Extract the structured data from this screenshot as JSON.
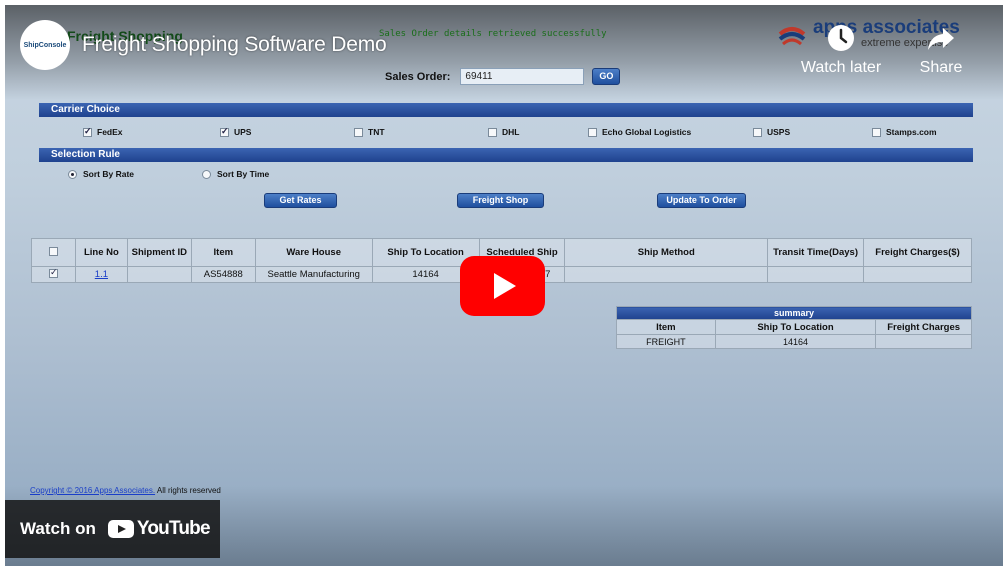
{
  "app": {
    "title": "Freight Shopping",
    "status_message": "Sales Order details retrieved successfully",
    "vendor_name": "apps associates",
    "vendor_tagline": "extreme expertise"
  },
  "sales_order": {
    "label": "Sales Order:",
    "value": "69411",
    "go_label": "GO"
  },
  "carrier_choice": {
    "title": "Carrier Choice",
    "carriers": [
      {
        "label": "FedEx",
        "checked": true
      },
      {
        "label": "UPS",
        "checked": true
      },
      {
        "label": "TNT",
        "checked": false
      },
      {
        "label": "DHL",
        "checked": false
      },
      {
        "label": "Echo Global Logistics",
        "checked": false
      },
      {
        "label": "USPS",
        "checked": false
      },
      {
        "label": "Stamps.com",
        "checked": false
      }
    ]
  },
  "selection_rule": {
    "title": "Selection Rule",
    "options": [
      {
        "label": "Sort By Rate",
        "selected": true
      },
      {
        "label": "Sort By Time",
        "selected": false
      }
    ]
  },
  "actions": {
    "get_rates": "Get Rates",
    "freight_shop": "Freight Shop",
    "update_to_order": "Update To Order"
  },
  "lines_table": {
    "headers": [
      "Line No",
      "Shipment ID",
      "Item",
      "Ware House",
      "Ship To Location",
      "Scheduled Ship",
      "Ship Method",
      "Transit Time(Days)",
      "Freight Charges($)"
    ],
    "rows": [
      {
        "checked": true,
        "line_no": "1.1",
        "shipment_id": "",
        "item": "AS54888",
        "warehouse": "Seattle Manufacturing",
        "ship_to": "14164",
        "scheduled_ship": "7",
        "ship_method": "",
        "transit_time": "",
        "freight_charges": ""
      }
    ]
  },
  "summary": {
    "title": "summary",
    "headers": [
      "Item",
      "Ship To Location",
      "Freight Charges"
    ],
    "rows": [
      {
        "item": "FREIGHT",
        "ship_to": "14164",
        "freight_charges": ""
      }
    ]
  },
  "footer": {
    "copyright_link": "Copyright © 2016 Apps Associates.",
    "copyright_text": "All rights reserved"
  },
  "youtube": {
    "channel_name": "ShipConsole",
    "video_title": "Freight Shopping Software Demo",
    "watch_later": "Watch later",
    "share": "Share",
    "watch_on": "Watch on",
    "youtube_brand": "YouTube",
    "play_color": "#ff0000"
  }
}
